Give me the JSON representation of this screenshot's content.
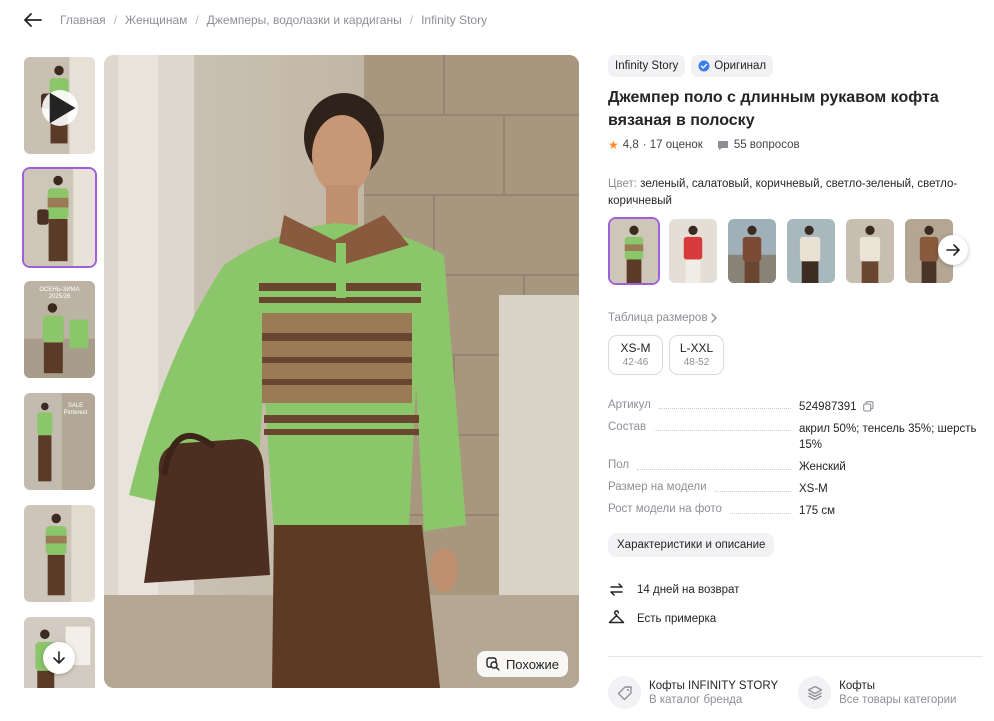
{
  "breadcrumbs": [
    "Главная",
    "Женщинам",
    "Джемперы, водолазки и кардиганы",
    "Infinity Story"
  ],
  "thumb_texts": {
    "t3": "ОСЕНЬ-ЗИМА 2025/26",
    "t4": "SALE Pinterest"
  },
  "similar_label": "Похожие",
  "brand_chip": "Infinity Story",
  "original_chip": "Оригинал",
  "title": "Джемпер поло с длинным рукавом кофта вязаная в полоску",
  "rating": "4,8",
  "rating_count": "· 17 оценок",
  "questions": "55 вопросов",
  "color_label": "Цвет:",
  "color_value": "зеленый, салатовый, коричневый, светло-зеленый, светло-коричневый",
  "size_table_link": "Таблица размеров",
  "sizes": [
    {
      "label": "XS-M",
      "range": "42-46"
    },
    {
      "label": "L-XXL",
      "range": "48-52"
    }
  ],
  "specs": [
    {
      "key": "Артикул",
      "value": "524987391"
    },
    {
      "key": "Состав",
      "value": "акрил 50%; тенсель 35%; шерсть 15%"
    },
    {
      "key": "Пол",
      "value": "Женский"
    },
    {
      "key": "Размер на модели",
      "value": "XS-M"
    },
    {
      "key": "Рост модели на фото",
      "value": "175 см"
    }
  ],
  "desc_button": "Характеристики и описание",
  "perks": [
    "14 дней на возврат",
    "Есть примерка"
  ],
  "bottom_links": [
    {
      "title": "Кофты INFINITY STORY",
      "subtitle": "В каталог бренда"
    },
    {
      "title": "Кофты",
      "subtitle": "Все товары категории"
    }
  ],
  "colors": {
    "accent_purple": "#a05fd9",
    "verified_blue": "#3a7bf0",
    "star_orange": "#ff8a2a",
    "sweater_green": "#8bc66a",
    "stripe_brown": "#6a4630"
  },
  "icons": [
    "back-arrow-icon",
    "play-icon",
    "arrow-down-icon",
    "similar-search-icon",
    "verified-check-icon",
    "star-icon",
    "question-icon",
    "chevron-right-icon",
    "arrow-right-icon",
    "copy-icon",
    "return-arrows-icon",
    "hanger-icon",
    "tag-icon",
    "layers-icon"
  ]
}
